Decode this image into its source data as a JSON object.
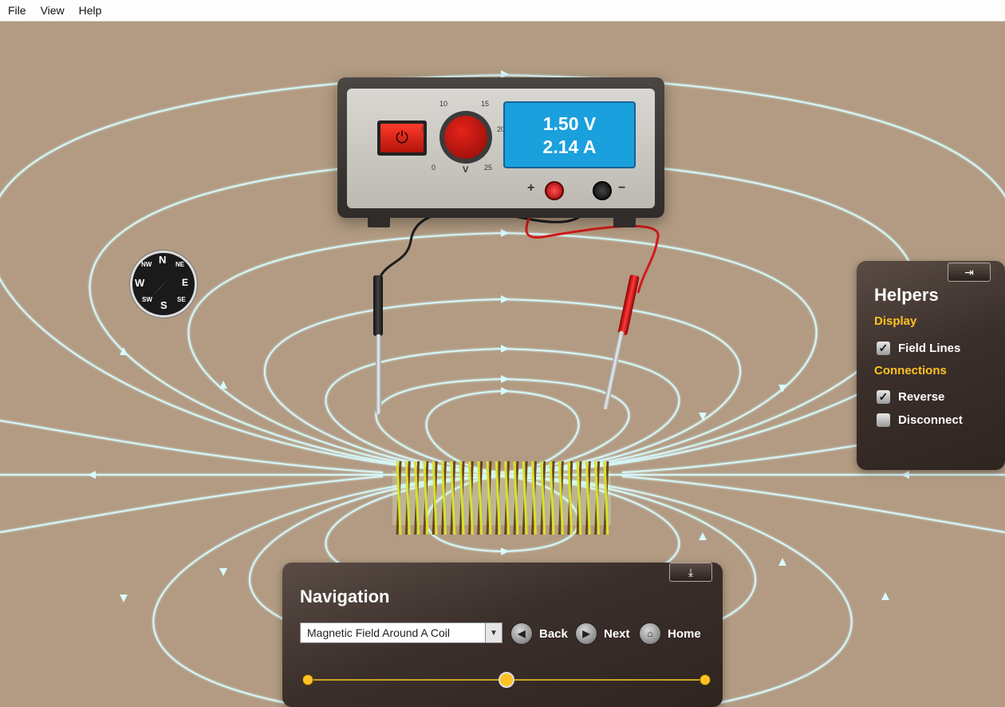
{
  "menu": [
    "File",
    "View",
    "Help"
  ],
  "power_supply": {
    "voltage": "1.50 V",
    "current": "2.14 A",
    "dial_ticks": [
      "0",
      "5",
      "10",
      "15",
      "20",
      "25"
    ],
    "dial_unit": "V",
    "plus": "+",
    "minus": "−",
    "power_icon": "⏻"
  },
  "compass": {
    "n": "N",
    "ne": "NE",
    "e": "E",
    "se": "SE",
    "s": "S",
    "sw": "SW",
    "w": "W",
    "nw": "NW"
  },
  "helpers": {
    "title": "Helpers",
    "collapse_icon": "⇥",
    "display_label": "Display",
    "field_lines": {
      "label": "Field Lines",
      "checked": true
    },
    "connections_label": "Connections",
    "reverse": {
      "label": "Reverse",
      "checked": true
    },
    "disconnect": {
      "label": "Disconnect",
      "checked": false
    }
  },
  "navigation": {
    "title": "Navigation",
    "collapse_icon": "⤓",
    "selected": "Magnetic Field Around A Coil",
    "back": "Back",
    "next": "Next",
    "home": "Home",
    "progress_steps": 3,
    "current_step": 2
  },
  "colors": {
    "background": "#b29b82",
    "field_line": "#d8fbff",
    "accent": "#ffc222",
    "display": "#1aa0dc"
  }
}
